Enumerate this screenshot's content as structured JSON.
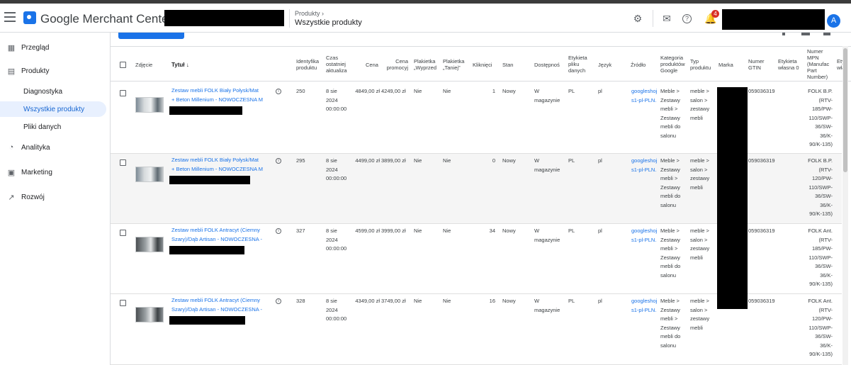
{
  "header": {
    "app_title": "Google Merchant Center",
    "breadcrumb_parent": "Produkty",
    "breadcrumb_title": "Wszystkie produkty",
    "notification_count": "4",
    "avatar_letter": "A"
  },
  "sidebar": {
    "items": [
      {
        "label": "Przegląd",
        "icon": "overview-icon"
      },
      {
        "label": "Produkty",
        "icon": "products-icon"
      },
      {
        "label": "Analityka",
        "icon": "analytics-icon"
      },
      {
        "label": "Marketing",
        "icon": "marketing-icon"
      },
      {
        "label": "Rozwój",
        "icon": "growth-icon"
      }
    ],
    "sub_items": [
      {
        "label": "Diagnostyka"
      },
      {
        "label": "Wszystkie produkty",
        "active": true
      },
      {
        "label": "Pliki danych"
      }
    ]
  },
  "table": {
    "headers": {
      "photo": "Zdjęcie",
      "title": "Tytuł ↓",
      "id": [
        "Identyfika",
        "produktu"
      ],
      "last_update": [
        "Czas",
        "ostatniej",
        "aktualiza"
      ],
      "price": "Cena",
      "promo_price": [
        "Cena",
        "promocyj"
      ],
      "label_sale": [
        "Plakietka",
        "„Wyprzed"
      ],
      "label_cheaper": [
        "Plakietka",
        "„Taniej”"
      ],
      "clicks": "Kliknięci",
      "condition": "Stan",
      "availability": "Dostępnoś",
      "feed_label": [
        "Etykieta",
        "pliku",
        "danych"
      ],
      "language": "Język",
      "source": "Źródło",
      "category": [
        "Kategoria",
        "produktów",
        "Google"
      ],
      "product_type": [
        "Typ",
        "produktu"
      ],
      "brand": "Marka",
      "gtin": [
        "Numer",
        "GTIN"
      ],
      "custom_label": [
        "Etykieta",
        "własna 0"
      ],
      "mpn": [
        "Numer",
        "MPN",
        "(Manufac",
        "Part",
        "Number)"
      ],
      "extra": [
        "Ety",
        "wła"
      ]
    },
    "rows": [
      {
        "title": [
          "Zestaw mebli FOLK Biały Połysk/Mat",
          "+ Beton Millenium - NOWOCZESNA M"
        ],
        "id": "250",
        "updated": [
          "8 sie",
          "2024",
          "00:00:00"
        ],
        "price": "4849,00 zł",
        "promo": "4249,00 zł",
        "sale": "Nie",
        "cheaper": "Nie",
        "clicks": "1",
        "condition": "Nowy",
        "availability": [
          "W",
          "magazynie"
        ],
        "feed_label": "PL",
        "language": "pl",
        "source": [
          "googleshoj",
          "s1-pl-PLN.:"
        ],
        "category": [
          "Meble >",
          "Zestawy",
          "mebli >",
          "Zestawy",
          "mebli do",
          "salonu"
        ],
        "product_type": [
          "meble >",
          "salon >",
          "zestawy",
          "mebli"
        ],
        "gtin": "05903631⁠9",
        "mpn": [
          "FOLK B.P.",
          "(RTV-",
          "185/PW-",
          "110/SWP-",
          "36/SW-",
          "36/K-",
          "90/K-135)"
        ]
      },
      {
        "title": [
          "Zestaw mebli FOLK Biały Połysk/Mat",
          "+ Beton Millenium - NOWOCZESNA M"
        ],
        "id": "295",
        "updated": [
          "8 sie",
          "2024",
          "00:00:00"
        ],
        "price": "4499,00 zł",
        "promo": "3899,00 zł",
        "sale": "Nie",
        "cheaper": "Nie",
        "clicks": "0",
        "condition": "Nowy",
        "availability": [
          "W",
          "magazynie"
        ],
        "feed_label": "PL",
        "language": "pl",
        "source": [
          "googleshoj",
          "s1-pl-PLN.:"
        ],
        "category": [
          "Meble >",
          "Zestawy",
          "mebli >",
          "Zestawy",
          "mebli do",
          "salonu"
        ],
        "product_type": [
          "meble >",
          "salon >",
          "zestawy",
          "mebli"
        ],
        "gtin": "05903631⁠9",
        "mpn": [
          "FOLK B.P.",
          "(RTV-",
          "120/PW-",
          "110/SWP-",
          "36/SW-",
          "36/K-",
          "90/K-135)"
        ]
      },
      {
        "title": [
          "Zestaw mebli FOLK Antracyt (Ciemny",
          "Szary)/Dąb Artisan - NOWOCZESNA -"
        ],
        "id": "327",
        "updated": [
          "8 sie",
          "2024",
          "00:00:00"
        ],
        "price": "4599,00 zł",
        "promo": "3999,00 zł",
        "sale": "Nie",
        "cheaper": "Nie",
        "clicks": "34",
        "condition": "Nowy",
        "availability": [
          "W",
          "magazynie"
        ],
        "feed_label": "PL",
        "language": "pl",
        "source": [
          "googleshoj",
          "s1-pl-PLN.:"
        ],
        "category": [
          "Meble >",
          "Zestawy",
          "mebli >",
          "Zestawy",
          "mebli do",
          "salonu"
        ],
        "product_type": [
          "meble >",
          "salon >",
          "zestawy",
          "mebli"
        ],
        "gtin": "05903631⁠9",
        "mpn": [
          "FOLK Ant.",
          "(RTV-",
          "185/PW-",
          "110/SWP-",
          "36/SW-",
          "36/K-",
          "90/K-135)"
        ]
      },
      {
        "title": [
          "Zestaw mebli FOLK Antracyt (Ciemny",
          "Szary)/Dąb Artisan - NOWOCZESNA -"
        ],
        "id": "328",
        "updated": [
          "8 sie",
          "2024",
          "00:00:00"
        ],
        "price": "4349,00 zł",
        "promo": "3749,00 zł",
        "sale": "Nie",
        "cheaper": "Nie",
        "clicks": "16",
        "condition": "Nowy",
        "availability": [
          "W",
          "magazynie"
        ],
        "feed_label": "PL",
        "language": "pl",
        "source": [
          "googleshoj",
          "s1-pl-PLN.:"
        ],
        "category": [
          "Meble >",
          "Zestawy",
          "mebli >",
          "Zestawy",
          "mebli do",
          "salonu"
        ],
        "product_type": [
          "meble >",
          "salon >",
          "zestawy",
          "mebli"
        ],
        "gtin": "05903631⁠9",
        "mpn": [
          "FOLK Ant.",
          "(RTV-",
          "120/PW-",
          "110/SWP-",
          "36/SW-",
          "36/K-",
          "90/K-135)"
        ]
      }
    ]
  }
}
